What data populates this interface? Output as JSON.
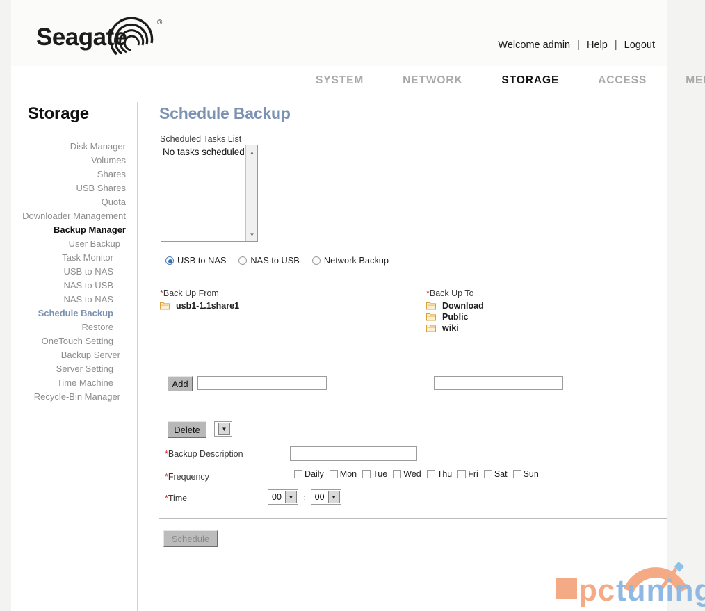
{
  "header": {
    "logo_text": "Seagate",
    "logo_registered": "®",
    "logo_mark_name": "seagate-swirl-logo",
    "welcome": "Welcome admin",
    "help": "Help",
    "logout": "Logout",
    "separator": "|"
  },
  "nav": {
    "items": [
      {
        "label": "SYSTEM",
        "active": false
      },
      {
        "label": "NETWORK",
        "active": false
      },
      {
        "label": "STORAGE",
        "active": true
      },
      {
        "label": "ACCESS",
        "active": false
      },
      {
        "label": "MEDIA",
        "active": false
      }
    ]
  },
  "sidebar": {
    "title": "Storage",
    "items": [
      {
        "label": "Disk Manager",
        "level": 1,
        "state": "normal"
      },
      {
        "label": "Volumes",
        "level": 1,
        "state": "normal"
      },
      {
        "label": "Shares",
        "level": 1,
        "state": "normal"
      },
      {
        "label": "USB Shares",
        "level": 1,
        "state": "normal"
      },
      {
        "label": "Quota",
        "level": 1,
        "state": "normal"
      },
      {
        "label": "Downloader Management",
        "level": 1,
        "state": "normal"
      },
      {
        "label": "Backup Manager",
        "level": 1,
        "state": "bold"
      },
      {
        "label": "User Backup",
        "level": 2,
        "state": "normal"
      },
      {
        "label": "Task Monitor",
        "level": 3,
        "state": "normal"
      },
      {
        "label": "USB to NAS",
        "level": 3,
        "state": "normal"
      },
      {
        "label": "NAS to USB",
        "level": 3,
        "state": "normal"
      },
      {
        "label": "NAS to NAS",
        "level": 3,
        "state": "normal"
      },
      {
        "label": "Schedule Backup",
        "level": 3,
        "state": "selected"
      },
      {
        "label": "Restore",
        "level": 3,
        "state": "normal"
      },
      {
        "label": "OneTouch Setting",
        "level": 3,
        "state": "normal"
      },
      {
        "label": "Backup Server",
        "level": 2,
        "state": "normal"
      },
      {
        "label": "Server Setting",
        "level": 3,
        "state": "normal"
      },
      {
        "label": "Time Machine",
        "level": 3,
        "state": "normal"
      },
      {
        "label": "Recycle-Bin Manager",
        "level": 2,
        "state": "normal"
      }
    ]
  },
  "main": {
    "page_title": "Schedule Backup",
    "tasks": {
      "label": "Scheduled Tasks List",
      "options": [
        "No tasks scheduled"
      ],
      "scroll_up_icon": "▲",
      "scroll_down_icon": "▼"
    },
    "mode_radios": [
      {
        "label": "USB to NAS",
        "selected": true
      },
      {
        "label": "NAS to USB",
        "selected": false
      },
      {
        "label": "Network Backup",
        "selected": false
      }
    ],
    "backup_from": {
      "label": "Back Up From",
      "required_star": "*",
      "folders": [
        "usb1-1.1share1"
      ]
    },
    "backup_to": {
      "label": "Back Up To",
      "required_star": "*",
      "folders": [
        "Download",
        "Public",
        "wiki"
      ]
    },
    "add_row": {
      "button_label": "Add",
      "left_input_value": "",
      "left_input_placeholder": "",
      "right_input_value": "",
      "right_input_placeholder": ""
    },
    "delete_row": {
      "button_label": "Delete",
      "select_value": "",
      "select_arrow_icon": "▼"
    },
    "description": {
      "label": "Backup Description",
      "required_star": "*",
      "value": "",
      "placeholder": ""
    },
    "frequency": {
      "label": "Frequency",
      "required_star": "*",
      "options": [
        {
          "label": "Daily",
          "checked": false
        },
        {
          "label": "Mon",
          "checked": false
        },
        {
          "label": "Tue",
          "checked": false
        },
        {
          "label": "Wed",
          "checked": false
        },
        {
          "label": "Thu",
          "checked": false
        },
        {
          "label": "Fri",
          "checked": false
        },
        {
          "label": "Sat",
          "checked": false
        },
        {
          "label": "Sun",
          "checked": false
        }
      ]
    },
    "time": {
      "label": "Time",
      "required_star": "*",
      "hour": "00",
      "minute": "00",
      "separator": ":",
      "arrow_icon": "▼"
    },
    "schedule_button": {
      "label": "Schedule",
      "disabled": true
    }
  },
  "watermark": {
    "text_pc": "pc",
    "text_tuning": "tuning",
    "color_orange": "#f0a882",
    "color_blue": "#7fb0dd"
  }
}
